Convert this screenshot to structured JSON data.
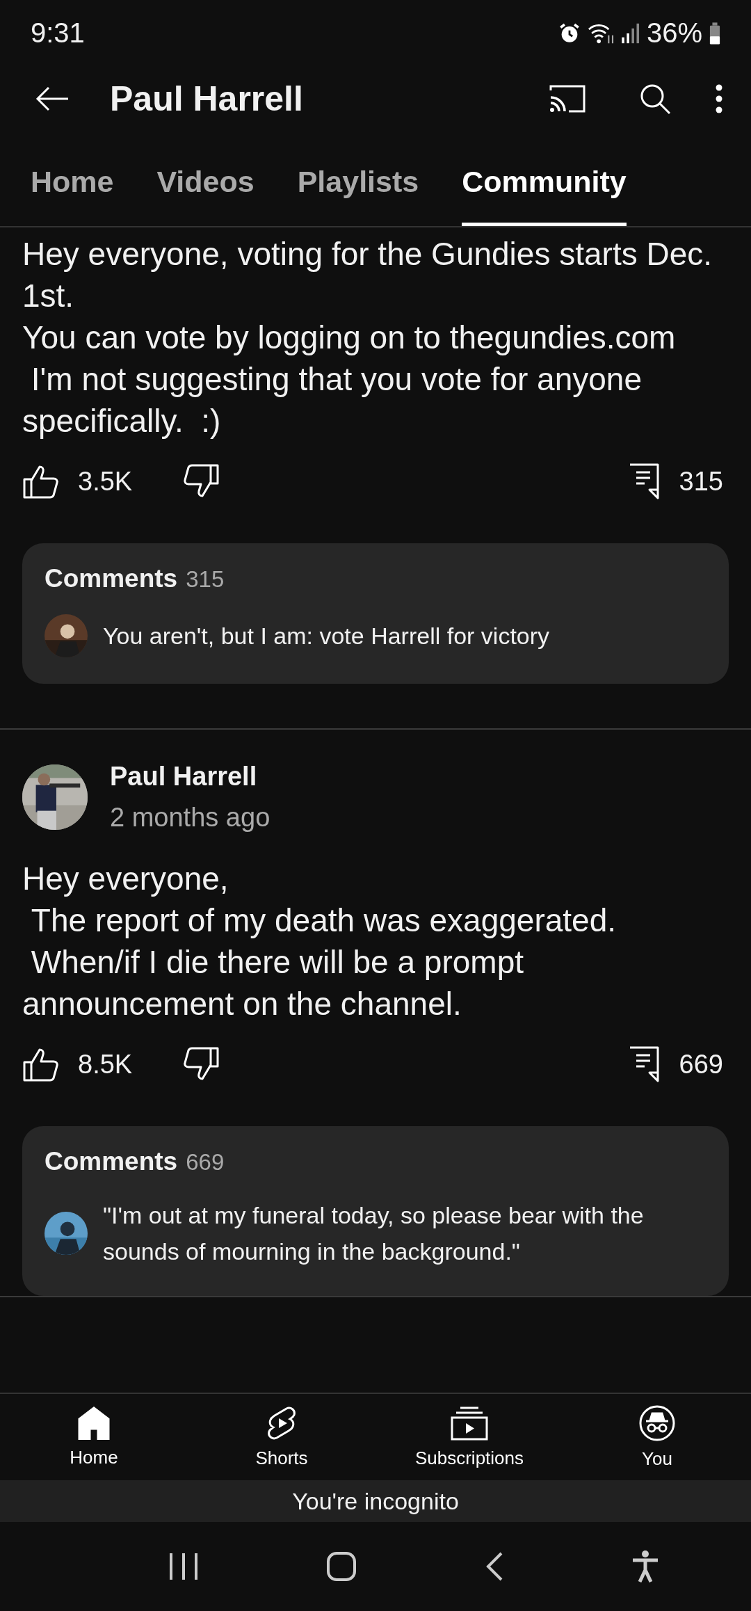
{
  "status_bar": {
    "time": "9:31",
    "battery": "36%"
  },
  "header": {
    "title": "Paul Harrell"
  },
  "tabs": [
    {
      "label": "Home",
      "selected": false
    },
    {
      "label": "Videos",
      "selected": false
    },
    {
      "label": "Playlists",
      "selected": false
    },
    {
      "label": "Community",
      "selected": true
    }
  ],
  "posts": [
    {
      "text": "Hey everyone, voting for the Gundies starts Dec. 1st.\nYou can vote by logging on to thegundies.com\n I'm not suggesting that you vote for anyone specifically.  :)",
      "likes": "3.5K",
      "comment_count": "315",
      "comments": {
        "title": "Comments",
        "count": "315",
        "top_comment": "You aren't, but I am: vote Harrell for victory"
      }
    },
    {
      "author": "Paul Harrell",
      "time": "2 months ago",
      "text": "Hey everyone,\n The report of my death was exaggerated.\n When/if I die there will be a prompt announcement on the channel.",
      "likes": "8.5K",
      "comment_count": "669",
      "comments": {
        "title": "Comments",
        "count": "669",
        "top_comment": "\"I'm out at my funeral today, so please bear with the sounds of mourning in the background.\""
      }
    }
  ],
  "bottom_nav": [
    {
      "kind": "home",
      "label": "Home",
      "selected": true
    },
    {
      "kind": "shorts",
      "label": "Shorts",
      "selected": false
    },
    {
      "kind": "subscriptions",
      "label": "Subscriptions",
      "selected": false
    },
    {
      "kind": "you",
      "label": "You",
      "selected": false
    }
  ],
  "incognito_banner": "You're incognito"
}
